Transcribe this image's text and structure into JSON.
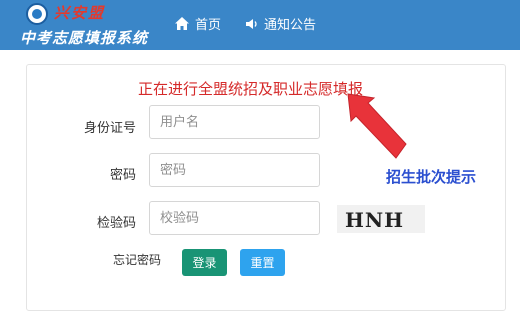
{
  "header": {
    "brand": "兴安盟",
    "system_title": "中考志愿填报系统",
    "nav": [
      {
        "label": "首页",
        "icon": "home-icon"
      },
      {
        "label": "通知公告",
        "icon": "speaker-icon"
      }
    ]
  },
  "login": {
    "notice": "正在进行全盟统招及职业志愿填报",
    "id_label": "身份证号",
    "id_placeholder": "用户名",
    "password_label": "密码",
    "password_placeholder": "密码",
    "captcha_label": "检验码",
    "captcha_placeholder": "校验码",
    "captcha_text": "HNH",
    "forgot": "忘记密码",
    "login_button": "登录",
    "reset_button": "重置"
  },
  "annotation": {
    "hint": "招生批次提示",
    "arrow_color": "#e8333a"
  },
  "colors": {
    "header_bg": "#3a86c8",
    "notice_red": "#d52a2a",
    "login_green": "#199475",
    "reset_blue": "#2ea3ee",
    "hint_blue": "#2b4fd0"
  }
}
